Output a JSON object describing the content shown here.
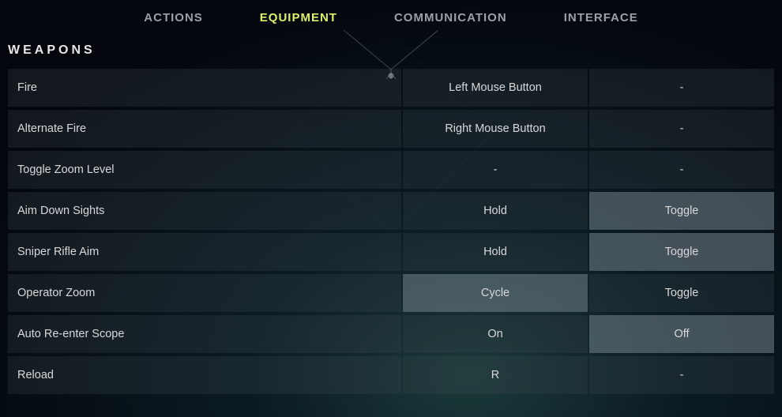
{
  "tabs": [
    {
      "label": "ACTIONS",
      "active": false
    },
    {
      "label": "EQUIPMENT",
      "active": true
    },
    {
      "label": "COMMUNICATION",
      "active": false
    },
    {
      "label": "INTERFACE",
      "active": false
    }
  ],
  "section_title": "WEAPONS",
  "rows": [
    {
      "label": "Fire",
      "opt1": "Left Mouse Button",
      "opt2": "-",
      "sel1": false,
      "sel2": false,
      "none2": true
    },
    {
      "label": "Alternate Fire",
      "opt1": "Right Mouse Button",
      "opt2": "-",
      "sel1": false,
      "sel2": false,
      "none2": true
    },
    {
      "label": "Toggle Zoom Level",
      "opt1": "-",
      "opt2": "-",
      "sel1": false,
      "sel2": false,
      "none1": true,
      "none2": true
    },
    {
      "label": "Aim Down Sights",
      "opt1": "Hold",
      "opt2": "Toggle",
      "sel1": false,
      "sel2": true
    },
    {
      "label": "Sniper Rifle Aim",
      "opt1": "Hold",
      "opt2": "Toggle",
      "sel1": false,
      "sel2": true
    },
    {
      "label": "Operator Zoom",
      "opt1": "Cycle",
      "opt2": "Toggle",
      "sel1": true,
      "sel2": false
    },
    {
      "label": "Auto Re-enter Scope",
      "opt1": "On",
      "opt2": "Off",
      "sel1": false,
      "sel2": true
    },
    {
      "label": "Reload",
      "opt1": "R",
      "opt2": "-",
      "sel1": false,
      "sel2": false,
      "none2": true
    }
  ]
}
